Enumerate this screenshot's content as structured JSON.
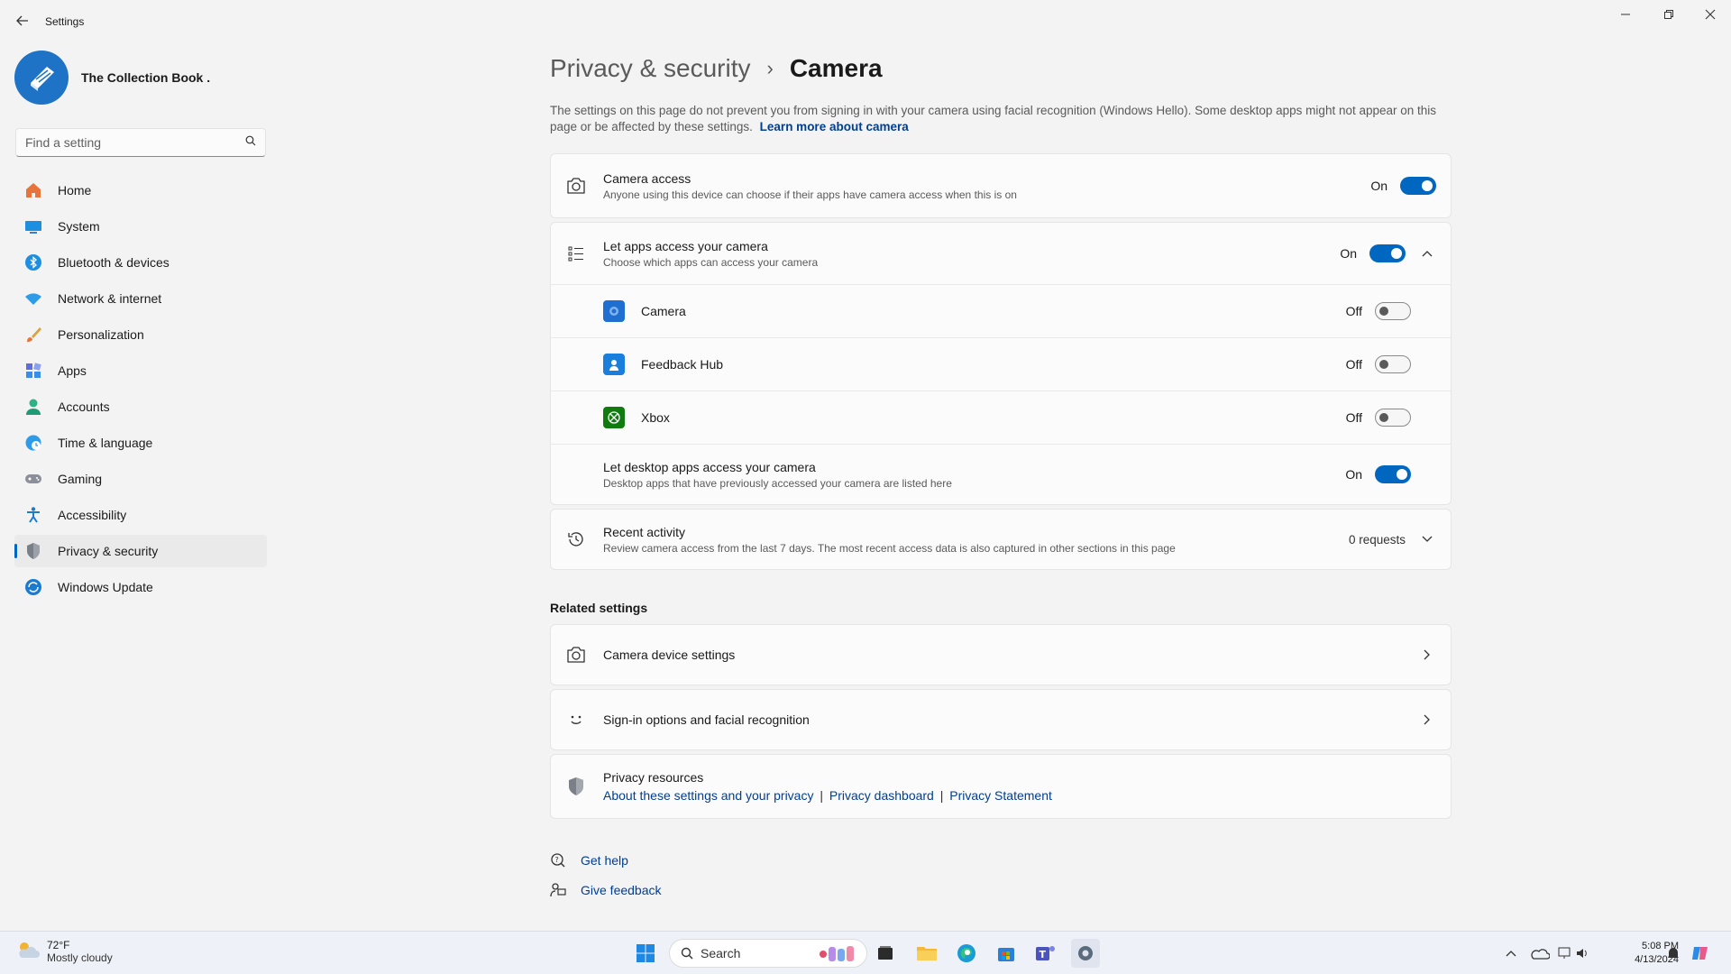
{
  "window": {
    "title": "Settings"
  },
  "profile": {
    "name": "The Collection Book ."
  },
  "search": {
    "placeholder": "Find a setting"
  },
  "nav": [
    {
      "label": "Home",
      "icon": "home-icon"
    },
    {
      "label": "System",
      "icon": "system-icon"
    },
    {
      "label": "Bluetooth & devices",
      "icon": "bluetooth-icon"
    },
    {
      "label": "Network & internet",
      "icon": "wifi-icon"
    },
    {
      "label": "Personalization",
      "icon": "brush-icon"
    },
    {
      "label": "Apps",
      "icon": "apps-icon"
    },
    {
      "label": "Accounts",
      "icon": "accounts-icon"
    },
    {
      "label": "Time & language",
      "icon": "clock-globe-icon"
    },
    {
      "label": "Gaming",
      "icon": "gamepad-icon"
    },
    {
      "label": "Accessibility",
      "icon": "accessibility-icon"
    },
    {
      "label": "Privacy & security",
      "icon": "shield-icon",
      "active": true
    },
    {
      "label": "Windows Update",
      "icon": "update-icon"
    }
  ],
  "breadcrumb": {
    "parent": "Privacy & security",
    "separator": "›",
    "current": "Camera"
  },
  "description": {
    "text": "The settings on this page do not prevent you from signing in with your camera using facial recognition (Windows Hello). Some desktop apps might not appear on this page or be affected by these settings.",
    "link": "Learn more about camera"
  },
  "camera_access": {
    "title": "Camera access",
    "subtitle": "Anyone using this device can choose if their apps have camera access when this is on",
    "state": "On"
  },
  "let_apps": {
    "title": "Let apps access your camera",
    "subtitle": "Choose which apps can access your camera",
    "state": "On",
    "apps": [
      {
        "name": "Camera",
        "state": "Off",
        "color": "#1f6fd1"
      },
      {
        "name": "Feedback Hub",
        "state": "Off",
        "color": "#1a7fdc"
      },
      {
        "name": "Xbox",
        "state": "Off",
        "color": "#107c10"
      }
    ],
    "desktop": {
      "title": "Let desktop apps access your camera",
      "subtitle": "Desktop apps that have previously accessed your camera are listed here",
      "state": "On"
    }
  },
  "recent_activity": {
    "title": "Recent activity",
    "subtitle": "Review camera access from the last 7 days. The most recent access data is also captured in other sections in this page",
    "count": "0 requests"
  },
  "related": {
    "heading": "Related settings",
    "items": [
      {
        "label": "Camera device settings"
      },
      {
        "label": "Sign-in options and facial recognition"
      }
    ]
  },
  "privacy_resources": {
    "title": "Privacy resources",
    "links": [
      "About these settings and your privacy",
      "Privacy dashboard",
      "Privacy Statement"
    ],
    "separator": "|"
  },
  "help": {
    "get_help": "Get help",
    "give_feedback": "Give feedback"
  },
  "taskbar": {
    "weather_temp": "72°F",
    "weather_desc": "Mostly cloudy",
    "search_label": "Search",
    "time": "5:08 PM",
    "date": "4/13/2024"
  },
  "colors": {
    "accent": "#0067c0",
    "link": "#003e92"
  }
}
